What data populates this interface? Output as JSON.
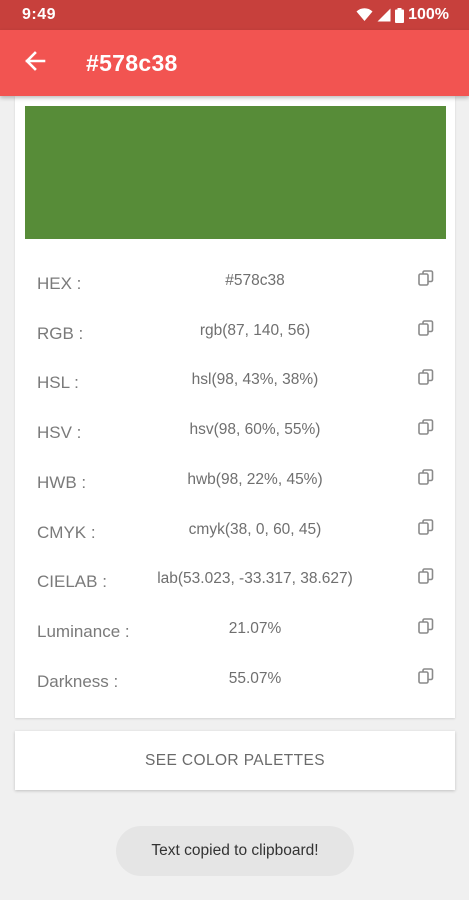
{
  "status_bar": {
    "time": "9:49",
    "battery": "100%",
    "icons": [
      "wifi-icon",
      "cell-signal-icon",
      "battery-icon"
    ]
  },
  "app_bar": {
    "title": "#578c38",
    "back_icon": "back-arrow-icon",
    "background": "#f25451"
  },
  "swatch": {
    "color": "#578c38"
  },
  "rows": [
    {
      "label": "HEX :",
      "value": "#578c38"
    },
    {
      "label": "RGB :",
      "value": "rgb(87, 140, 56)"
    },
    {
      "label": "HSL :",
      "value": "hsl(98, 43%, 38%)"
    },
    {
      "label": "HSV :",
      "value": "hsv(98, 60%, 55%)"
    },
    {
      "label": "HWB :",
      "value": "hwb(98, 22%, 45%)"
    },
    {
      "label": "CMYK :",
      "value": "cmyk(38, 0, 60, 45)"
    },
    {
      "label": "CIELAB :",
      "value": "lab(53.023, -33.317, 38.627)"
    },
    {
      "label": "Luminance :",
      "value": "21.07%"
    },
    {
      "label": "Darkness :",
      "value": "55.07%"
    }
  ],
  "copy_icon": "copy-icon",
  "palette_button": {
    "label": "SEE COLOR PALETTES"
  },
  "toast": {
    "text": "Text copied to clipboard!"
  }
}
